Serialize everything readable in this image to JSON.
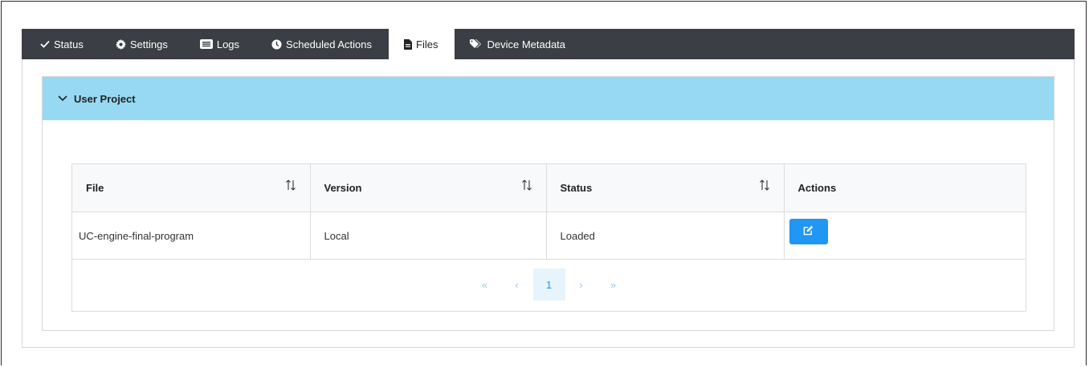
{
  "tabs": [
    {
      "label": "Status",
      "icon": "check-icon"
    },
    {
      "label": "Settings",
      "icon": "gear-icon"
    },
    {
      "label": "Logs",
      "icon": "list-icon"
    },
    {
      "label": "Scheduled Actions",
      "icon": "clock-icon"
    },
    {
      "label": "Files",
      "icon": "file-icon",
      "active": true
    },
    {
      "label": "Device Metadata",
      "icon": "tags-icon"
    }
  ],
  "panel": {
    "title": "User Project"
  },
  "table": {
    "columns": [
      "File",
      "Version",
      "Status",
      "Actions"
    ],
    "rows": [
      {
        "file": "UC-engine-final-program",
        "version": "Local",
        "status": "Loaded"
      }
    ]
  },
  "pagination": {
    "first": "«",
    "prev": "‹",
    "current": "1",
    "next": "›",
    "last": "»"
  },
  "colors": {
    "tabbar": "#3b3e44",
    "panel_header": "#97d9f2",
    "accent": "#2196f3"
  }
}
